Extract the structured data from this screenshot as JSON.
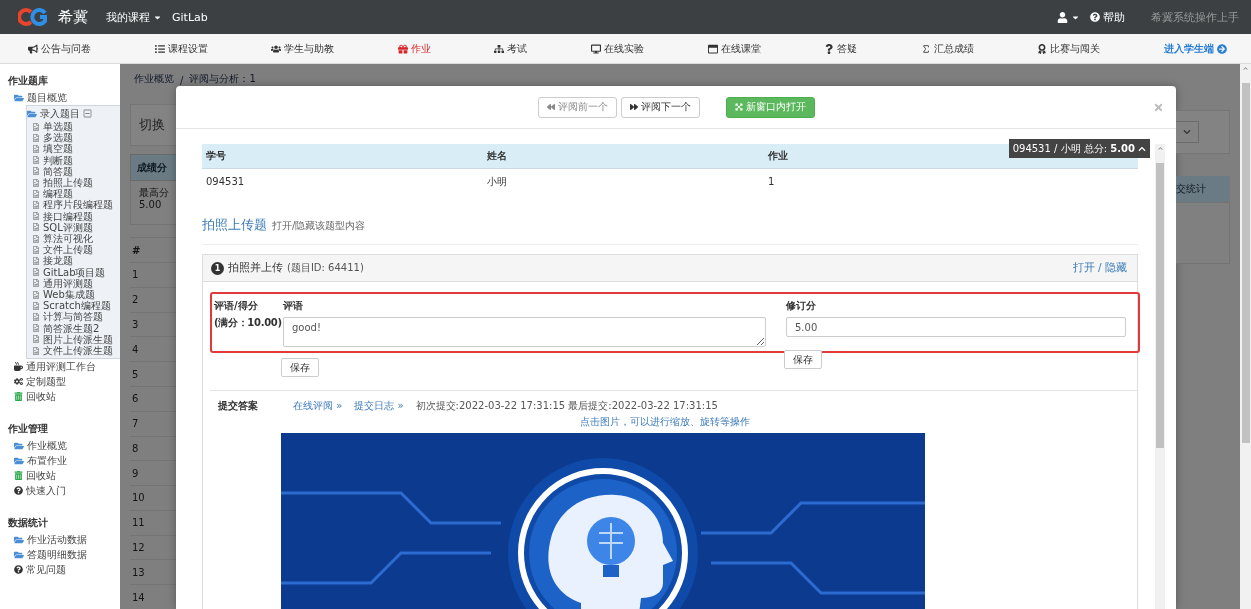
{
  "top_bar": {
    "brand": "希冀",
    "course_menu": "我的课程",
    "gitlab": "GitLab",
    "help": "帮助",
    "guide": "希冀系统操作上手"
  },
  "nav": [
    {
      "label": "公告与问卷",
      "kind": "tab",
      "selected": false
    },
    {
      "label": "课程设置",
      "kind": "tab",
      "selected": false
    },
    {
      "label": "学生与助教",
      "kind": "tab",
      "selected": false
    },
    {
      "label": "作业",
      "kind": "tab",
      "selected": true
    },
    {
      "label": "考试",
      "kind": "tab",
      "selected": false
    },
    {
      "label": "在线实验",
      "kind": "tab",
      "selected": false
    },
    {
      "label": "在线课堂",
      "kind": "tab",
      "selected": false
    },
    {
      "label": "答疑",
      "kind": "tab",
      "selected": false
    },
    {
      "label": "汇总成绩",
      "kind": "tab",
      "selected": false
    },
    {
      "label": "比赛与闯关",
      "kind": "tab",
      "selected": false
    },
    {
      "label": "进入学生端",
      "kind": "link",
      "selected": false
    }
  ],
  "sidebar": {
    "sections": [
      {
        "title": "作业题库",
        "items": [
          {
            "label": "题目概览",
            "kind": "folder"
          },
          {
            "label": "录入题目",
            "kind": "folder",
            "expanded": true,
            "children": [
              {
                "label": "单选题",
                "kind": "page"
              },
              {
                "label": "多选题",
                "kind": "page"
              },
              {
                "label": "填空题",
                "kind": "page"
              },
              {
                "label": "判断题",
                "kind": "page"
              },
              {
                "label": "简答题",
                "kind": "page"
              },
              {
                "label": "拍照上传题",
                "kind": "page"
              },
              {
                "label": "编程题",
                "kind": "page"
              },
              {
                "label": "程序片段编程题",
                "kind": "page"
              },
              {
                "label": "接口编程题",
                "kind": "page"
              },
              {
                "label": "SQL评测题",
                "kind": "page"
              },
              {
                "label": "算法可视化",
                "kind": "page"
              },
              {
                "label": "文件上传题",
                "kind": "page"
              },
              {
                "label": "接龙题",
                "kind": "page"
              },
              {
                "label": "GitLab项目题",
                "kind": "page"
              },
              {
                "label": "通用评测题",
                "kind": "page"
              },
              {
                "label": "Web集成题",
                "kind": "page"
              },
              {
                "label": "Scratch编程题",
                "kind": "page"
              },
              {
                "label": "计算与简答题",
                "kind": "page"
              },
              {
                "label": "简答派生题2",
                "kind": "page"
              },
              {
                "label": "图片上传派生题",
                "kind": "page"
              },
              {
                "label": "文件上传派生题",
                "kind": "page"
              }
            ]
          },
          {
            "label": "通用评测工作台",
            "kind": "tool"
          },
          {
            "label": "定制题型",
            "kind": "gears"
          },
          {
            "label": "回收站",
            "kind": "trash"
          }
        ]
      },
      {
        "title": "作业管理",
        "items": [
          {
            "label": "作业概览",
            "kind": "folder"
          },
          {
            "label": "布置作业",
            "kind": "folder"
          },
          {
            "label": "回收站",
            "kind": "trash"
          },
          {
            "label": "快速入门",
            "kind": "help"
          }
        ]
      },
      {
        "title": "数据统计",
        "items": [
          {
            "label": "作业活动数据",
            "kind": "folder"
          },
          {
            "label": "答题明细数据",
            "kind": "folder"
          },
          {
            "label": "常见问题",
            "kind": "help"
          }
        ]
      }
    ]
  },
  "background_page": {
    "breadcrumb": [
      "作业概览",
      "评阅与分析：1"
    ],
    "breadcrumb_separator": "/",
    "switch_label": "切换",
    "panel_title": "成绩分",
    "stat_label": "最高分",
    "stat_value": "5.00",
    "table_header": "#",
    "row_numbers": [
      "1",
      "2",
      "3",
      "4",
      "5",
      "6",
      "7",
      "8",
      "9",
      "10",
      "11",
      "12",
      "13",
      "14"
    ],
    "right_panel_title": "交统计"
  },
  "modal": {
    "prev_button": {
      "label": "评阅前一个",
      "disabled": true
    },
    "next_button": {
      "label": "评阅下一个",
      "disabled": false
    },
    "open_button": "新窗口内打开",
    "info_table": {
      "columns": [
        "学号",
        "姓名",
        "作业"
      ],
      "row": [
        "094531",
        "小明",
        "1"
      ]
    },
    "summary_badge": "094531 / 小明 总分: **5.00**",
    "section_title": "拍照上传题",
    "section_toggle": "打开/隐藏该题型内容",
    "question": {
      "number": "1",
      "title": "拍照并上传",
      "id_note": "(题目ID: 64411)",
      "toggle": "打开 / 隐藏",
      "grading": {
        "label": "评语/得分",
        "full_score": "(满分：10.00)",
        "comment_label": "评语",
        "comment_value": "good!",
        "score_label": "修订分",
        "score_value": "5.00",
        "save_comment": "保存",
        "save_score": "保存"
      },
      "answer": {
        "label": "提交答案",
        "review_link": "在线评阅 »",
        "log_link": "提交日志 »",
        "times": "初次提交:2022-03-22 17:31:15 最后提交:2022-03-22 17:31:15",
        "hint": "点击图片，可以进行缩放、旋转等操作"
      }
    }
  }
}
